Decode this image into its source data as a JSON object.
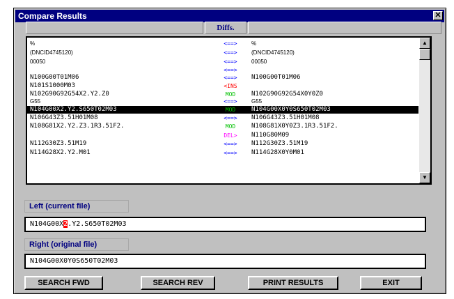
{
  "window": {
    "title": "Compare Results",
    "close_glyph": "✕"
  },
  "header": {
    "diffs_label": "Diffs."
  },
  "rows": [
    {
      "left": "%",
      "mid": "<==>",
      "mid_color": "#0000ff",
      "right": "%",
      "small": true
    },
    {
      "left": "(DNCID4745120)",
      "mid": "<==>",
      "mid_color": "#0000ff",
      "right": "(DNCID4745120)",
      "small": true
    },
    {
      "left": "00050",
      "mid": "<==>",
      "mid_color": "#0000ff",
      "right": "00050",
      "small": true
    },
    {
      "left": "",
      "mid": "<==>",
      "mid_color": "#0000ff",
      "right": "",
      "small": false
    },
    {
      "left": "N100G00T01M06",
      "mid": "<==>",
      "mid_color": "#0000ff",
      "right": "N100G00T01M06",
      "small": false
    },
    {
      "left": "N101S1000M03",
      "mid": "<INS",
      "mid_color": "#ff0000",
      "right": "",
      "small": false
    },
    {
      "left": "N102G90G92G54X2.Y2.Z0",
      "mid": "MOD",
      "mid_color": "#00c000",
      "right": "N102G90G92G54X0Y0Z0",
      "small": false
    },
    {
      "left": "G55",
      "mid": "<==>",
      "mid_color": "#0000ff",
      "right": "G55",
      "small": true
    },
    {
      "left": "N104G00X2.Y2.S650T02M03",
      "mid": "MOD",
      "mid_color": "#00c000",
      "right": "N104G00X0Y0S650T02M03",
      "small": false,
      "selected": true
    },
    {
      "left": "N106G43Z3.51H01M08",
      "mid": "<==>",
      "mid_color": "#0000ff",
      "right": "N106G43Z3.51H01M08",
      "small": false
    },
    {
      "left": "N108G81X2.Y2.Z3.1R3.51F2.",
      "mid": "MOD",
      "mid_color": "#00c000",
      "right": "N108G81X0Y0Z3.1R3.51F2.",
      "small": false
    },
    {
      "left": "",
      "mid": "DEL>",
      "mid_color": "#ff00ff",
      "right": "N110G80M09",
      "small": false
    },
    {
      "left": "N112G30Z3.51M19",
      "mid": "<==>",
      "mid_color": "#0000ff",
      "right": "N112G30Z3.51M19",
      "small": false
    },
    {
      "left": "N114G28X2.Y2.M01",
      "mid": "<==>",
      "mid_color": "#0000ff",
      "right": "N114G28X0Y0M01",
      "small": false
    }
  ],
  "scrollbar": {
    "up_icon": "▲",
    "down_icon": "▼"
  },
  "left_file": {
    "label": "Left (current file)",
    "before": "N104G00X",
    "highlight": "2",
    "after": ".Y2.S650T02M03"
  },
  "right_file": {
    "label": "Right (original file)",
    "value": "N104G00X0Y0S650T02M03"
  },
  "buttons": {
    "search_fwd": "SEARCH FWD",
    "search_rev": "SEARCH REV",
    "print_results": "PRINT RESULTS",
    "exit": "EXIT"
  }
}
